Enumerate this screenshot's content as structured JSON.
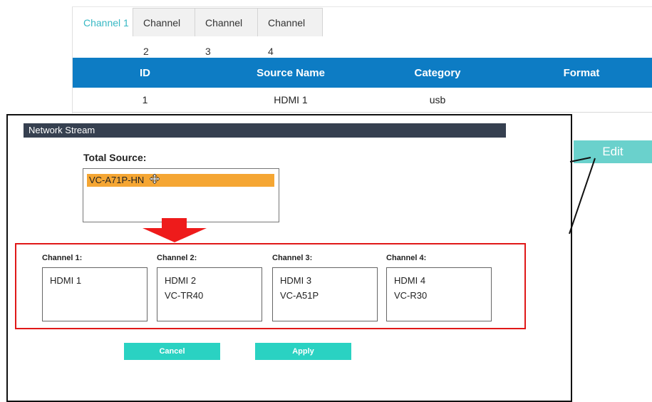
{
  "tabs": [
    {
      "label": "Channel 1",
      "active": true
    },
    {
      "label": "Channel 2",
      "active": false
    },
    {
      "label": "Channel 3",
      "active": false
    },
    {
      "label": "Channel 4",
      "active": false
    }
  ],
  "table": {
    "headers": [
      "ID",
      "Source Name",
      "Category",
      "Format"
    ],
    "rows": [
      {
        "id": "1",
        "source_name": "HDMI 1",
        "category": "usb",
        "format": ""
      }
    ]
  },
  "edit_label": "Edit",
  "dialog": {
    "title": "Network Stream",
    "total_source_label": "Total Source:",
    "total_source_items": [
      "VC-A71P-HN"
    ],
    "channels": [
      {
        "label": "Channel 1:",
        "items": [
          "HDMI 1"
        ]
      },
      {
        "label": "Channel 2:",
        "items": [
          "HDMI 2",
          "VC-TR40"
        ]
      },
      {
        "label": "Channel 3:",
        "items": [
          "HDMI 3",
          "VC-A51P"
        ]
      },
      {
        "label": "Channel 4:",
        "items": [
          "HDMI 4",
          "VC-R30"
        ]
      }
    ],
    "cancel_label": "Cancel",
    "apply_label": "Apply"
  },
  "colors": {
    "accent": "#37b8c4",
    "table_header": "#0d7cc4",
    "dialog_header": "#364050",
    "selected_item": "#f5a633",
    "highlight": "#e01818",
    "button": "#2ad2c2"
  },
  "icons": [
    "move-cursor-icon",
    "down-arrow-icon"
  ]
}
